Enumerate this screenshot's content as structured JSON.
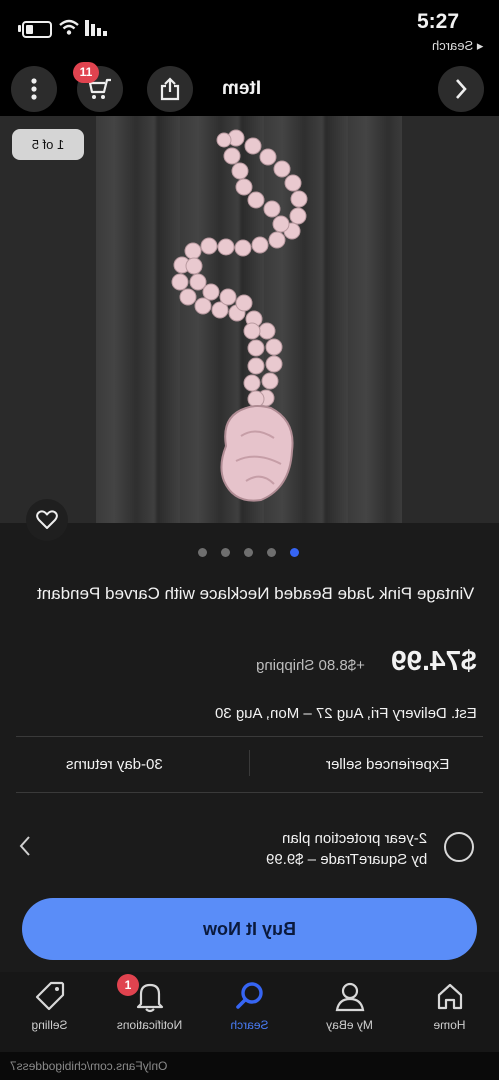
{
  "status_bar": {
    "time": "5:27",
    "back_label": "◂ Search"
  },
  "nav": {
    "title": "Item",
    "cart_count": "11"
  },
  "gallery": {
    "counter": "1 of 5",
    "dots": 5,
    "active_dot": 4
  },
  "item": {
    "title": "Vintage Pink Jade Beaded Necklace with Carved Pendant",
    "price": "$74.99",
    "shipping": "+$8.80 Shipping",
    "delivery": "Est. Delivery Fri, Aug 27 – Mon, Aug 30"
  },
  "features": {
    "left": "Experienced seller",
    "right": "30-day returns"
  },
  "protection": {
    "line1": "2-year protection plan",
    "line2": "by SquareTrade – $9.99"
  },
  "buy": {
    "label": "Buy It Now"
  },
  "tabs": [
    {
      "label": "Home",
      "icon": "home-icon"
    },
    {
      "label": "My eBay",
      "icon": "person-icon"
    },
    {
      "label": "Search",
      "icon": "search-icon"
    },
    {
      "label": "Notifications",
      "icon": "bell-icon"
    },
    {
      "label": "Selling",
      "icon": "tag-icon"
    }
  ],
  "notifications_count": "1",
  "watermark": "OnlyFans.com/chibigoddess7",
  "colors": {
    "accent": "#3665f3",
    "buy_button": "#5a8df8",
    "badge": "#e0434f",
    "background": "#1b1b1b"
  }
}
